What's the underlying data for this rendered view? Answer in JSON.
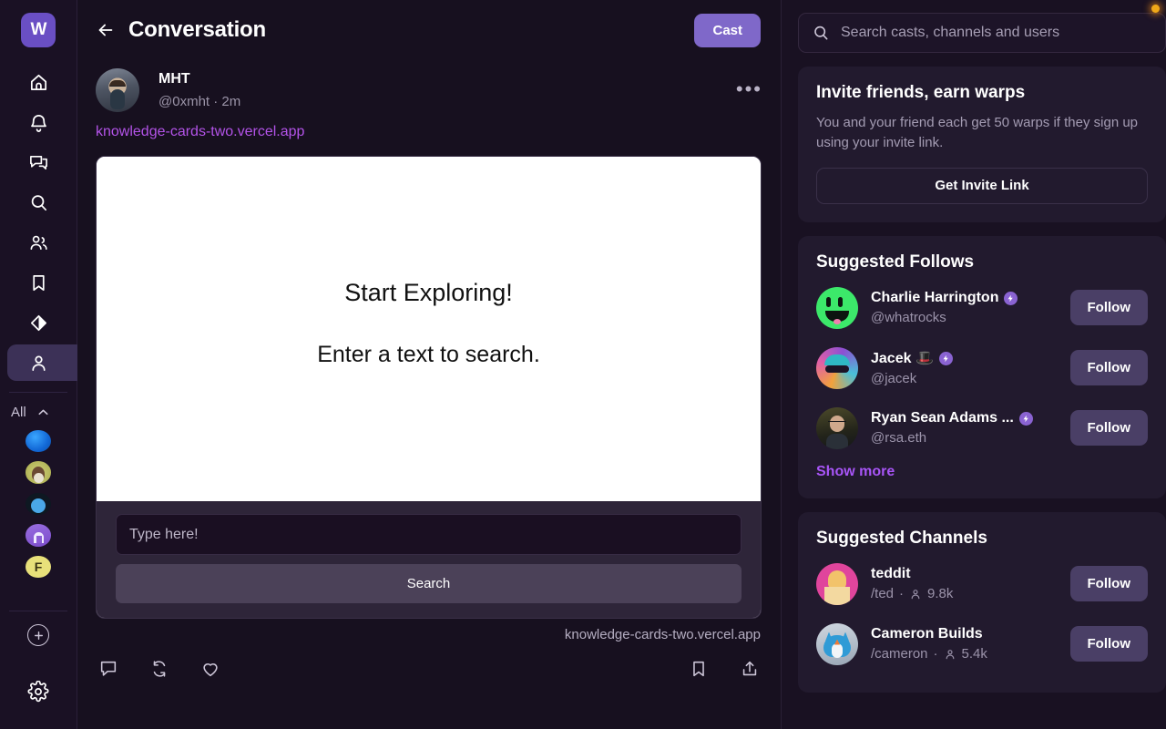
{
  "brand": {
    "logo_text": "W",
    "accent": "#7f68c9",
    "link": "#b353e8"
  },
  "rail": {
    "items": [
      {
        "name": "home",
        "icon": "home-icon",
        "active": false
      },
      {
        "name": "notifications",
        "icon": "bell-icon",
        "active": false
      },
      {
        "name": "messages",
        "icon": "chat-icon",
        "active": false
      },
      {
        "name": "search",
        "icon": "search-icon",
        "active": false
      },
      {
        "name": "channels",
        "icon": "people-icon",
        "active": false
      },
      {
        "name": "bookmarks",
        "icon": "bookmark-icon",
        "active": false
      },
      {
        "name": "warps",
        "icon": "diamond-icon",
        "active": false
      },
      {
        "name": "profile",
        "icon": "person-icon",
        "active": true
      }
    ],
    "all_label": "All",
    "all_chevron": "chevron-up-icon",
    "add_icon": "plus-circle-icon",
    "settings_icon": "gear-icon"
  },
  "conversation": {
    "back_icon": "arrow-left-icon",
    "title": "Conversation",
    "cast_label": "Cast",
    "more_icon": "ellipsis-icon",
    "cast": {
      "author_name": "MHT",
      "author_handle": "@0xmht",
      "separator": "·",
      "timestamp": "2m",
      "link_text": "knowledge-cards-two.vercel.app",
      "embed_domain": "knowledge-cards-two.vercel.app"
    },
    "embed": {
      "heading": "Start Exploring!",
      "subheading": "Enter a text to search.",
      "input_placeholder": "Type here!",
      "input_value": "",
      "search_label": "Search"
    },
    "actions": {
      "reply": "comment-icon",
      "recast": "recast-icon",
      "like": "heart-icon",
      "bookmark": "bookmark-icon",
      "share": "share-icon"
    }
  },
  "right": {
    "search": {
      "icon": "search-icon",
      "placeholder": "Search casts, channels and users",
      "value": ""
    },
    "invite": {
      "title": "Invite friends, earn warps",
      "body": "You and your friend each get 50 warps if they sign up using your invite link.",
      "button": "Get Invite Link"
    },
    "suggested_follows": {
      "title": "Suggested Follows",
      "show_more": "Show more",
      "users": [
        {
          "name": "Charlie Harrington",
          "handle": "@whatrocks",
          "verified": true,
          "follow": "Follow",
          "avatar": "green-monster"
        },
        {
          "name": "Jacek 🎩",
          "handle": "@jacek",
          "verified": true,
          "follow": "Follow",
          "avatar": "purple-gradient"
        },
        {
          "name": "Ryan Sean Adams ...",
          "handle": "@rsa.eth",
          "verified": true,
          "follow": "Follow",
          "avatar": "photo-portrait"
        }
      ]
    },
    "suggested_channels": {
      "title": "Suggested Channels",
      "channels": [
        {
          "name": "teddit",
          "slug": "/ted",
          "separator": "·",
          "members_icon": "person-icon",
          "members": "9.8k",
          "follow": "Follow",
          "avatar": "pink-woman"
        },
        {
          "name": "Cameron Builds",
          "slug": "/cameron",
          "separator": "·",
          "members_icon": "person-icon",
          "members": "5.4k",
          "follow": "Follow",
          "avatar": "blue-fox"
        }
      ]
    }
  }
}
